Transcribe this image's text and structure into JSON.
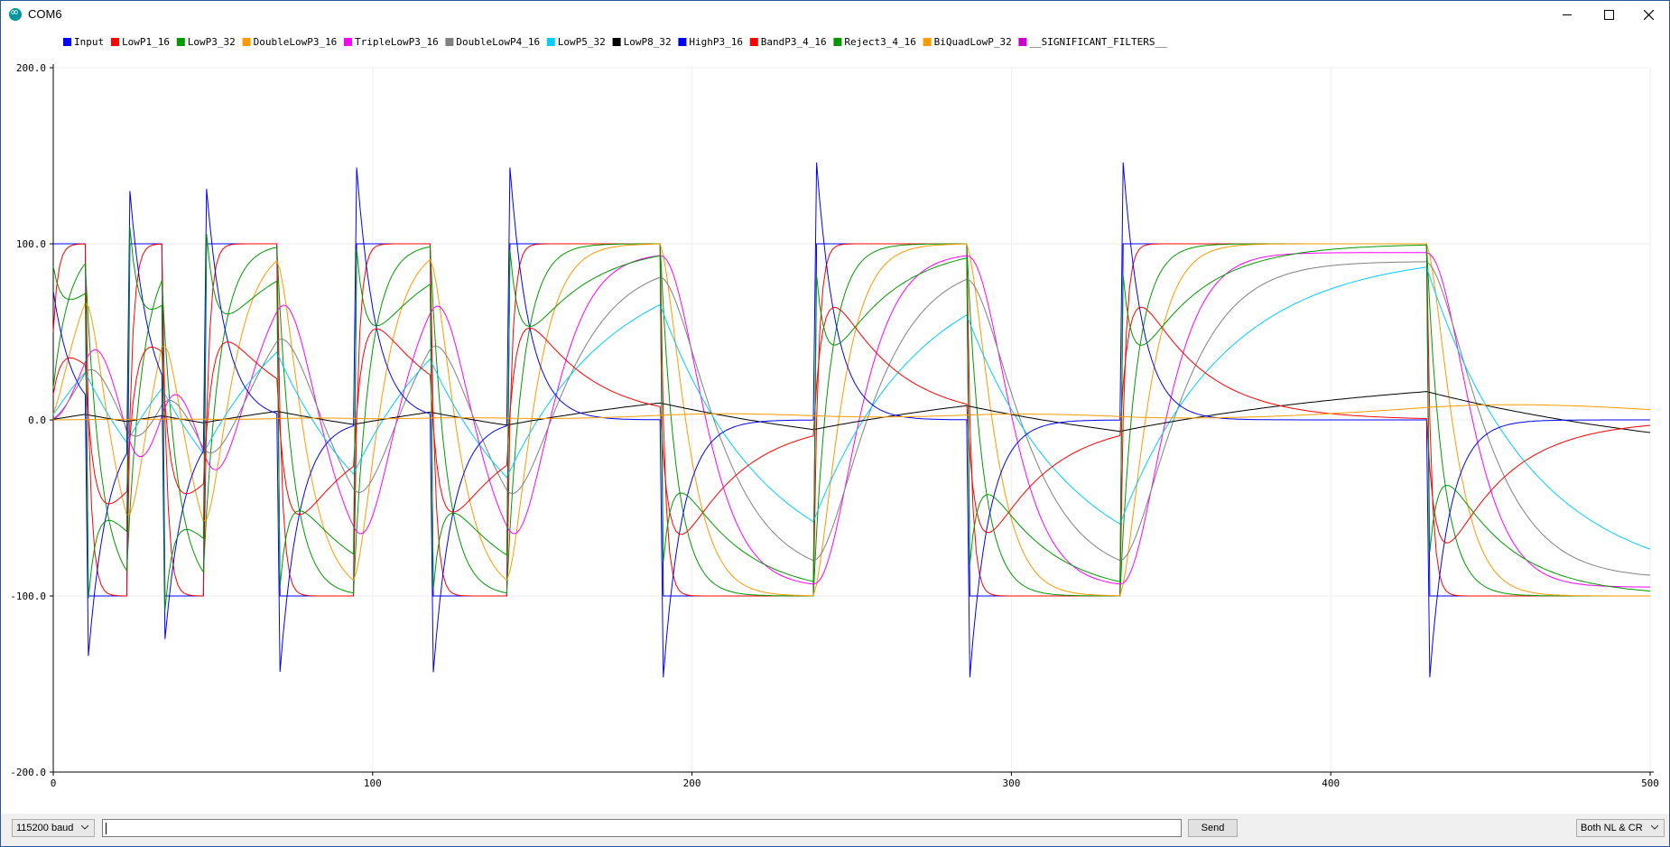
{
  "window": {
    "title": "COM6",
    "icon": "arduino-icon"
  },
  "legend": [
    {
      "label": "Input",
      "color": "#0000ff"
    },
    {
      "label": "LowP1_16",
      "color": "#ff0000"
    },
    {
      "label": "LowP3_32",
      "color": "#009900"
    },
    {
      "label": "DoubleLowP3_16",
      "color": "#ff9900"
    },
    {
      "label": "TripleLowP3_16",
      "color": "#ff00ff"
    },
    {
      "label": "DoubleLowP4_16",
      "color": "#808080"
    },
    {
      "label": "LowP5_32",
      "color": "#00ccff"
    },
    {
      "label": "LowP8_32",
      "color": "#000000"
    },
    {
      "label": "HighP3_16",
      "color": "#0000ff"
    },
    {
      "label": "BandP3_4_16",
      "color": "#ff0000"
    },
    {
      "label": "Reject3_4_16",
      "color": "#009900"
    },
    {
      "label": "BiQuadLowP_32",
      "color": "#ff9900"
    },
    {
      "label": "__SIGNIFICANT_FILTERS__",
      "color": "#cc00cc"
    }
  ],
  "chart_data": {
    "type": "line",
    "xlim": [
      0,
      500
    ],
    "ylim": [
      -200,
      200
    ],
    "xticks": [
      "0",
      "100",
      "200",
      "300",
      "400",
      "500"
    ],
    "yticks": [
      "200.0",
      "100.0",
      "0.0",
      "-100.0",
      "-200.0"
    ],
    "grid": true,
    "legend_position": "top",
    "input_square_wave_edges": [
      0,
      11,
      24,
      35,
      48,
      71,
      95,
      119,
      143,
      191,
      239,
      287,
      335,
      431,
      500
    ],
    "input_square_wave_levels": [
      100,
      -100,
      100,
      -100,
      100,
      -100,
      100,
      -100,
      100,
      -100,
      100,
      -100,
      100,
      -100
    ],
    "highpass_peaks": [
      {
        "x": 24,
        "y": 145
      },
      {
        "x": 48,
        "y": 146
      },
      {
        "x": 96,
        "y": 168
      },
      {
        "x": 144,
        "y": 167
      },
      {
        "x": 240,
        "y": 172
      },
      {
        "x": 336,
        "y": 172
      },
      {
        "x": 12,
        "y": -157
      },
      {
        "x": 36,
        "y": -145
      },
      {
        "x": 72,
        "y": -168
      },
      {
        "x": 120,
        "y": -167
      },
      {
        "x": 192,
        "y": -172
      },
      {
        "x": 288,
        "y": -172
      },
      {
        "x": 432,
        "y": -172
      }
    ],
    "series_visual_note": ""
  },
  "bottom": {
    "baud": "115200 baud",
    "send_label": "Send",
    "line_ending": "Both NL & CR",
    "input_value": ""
  }
}
